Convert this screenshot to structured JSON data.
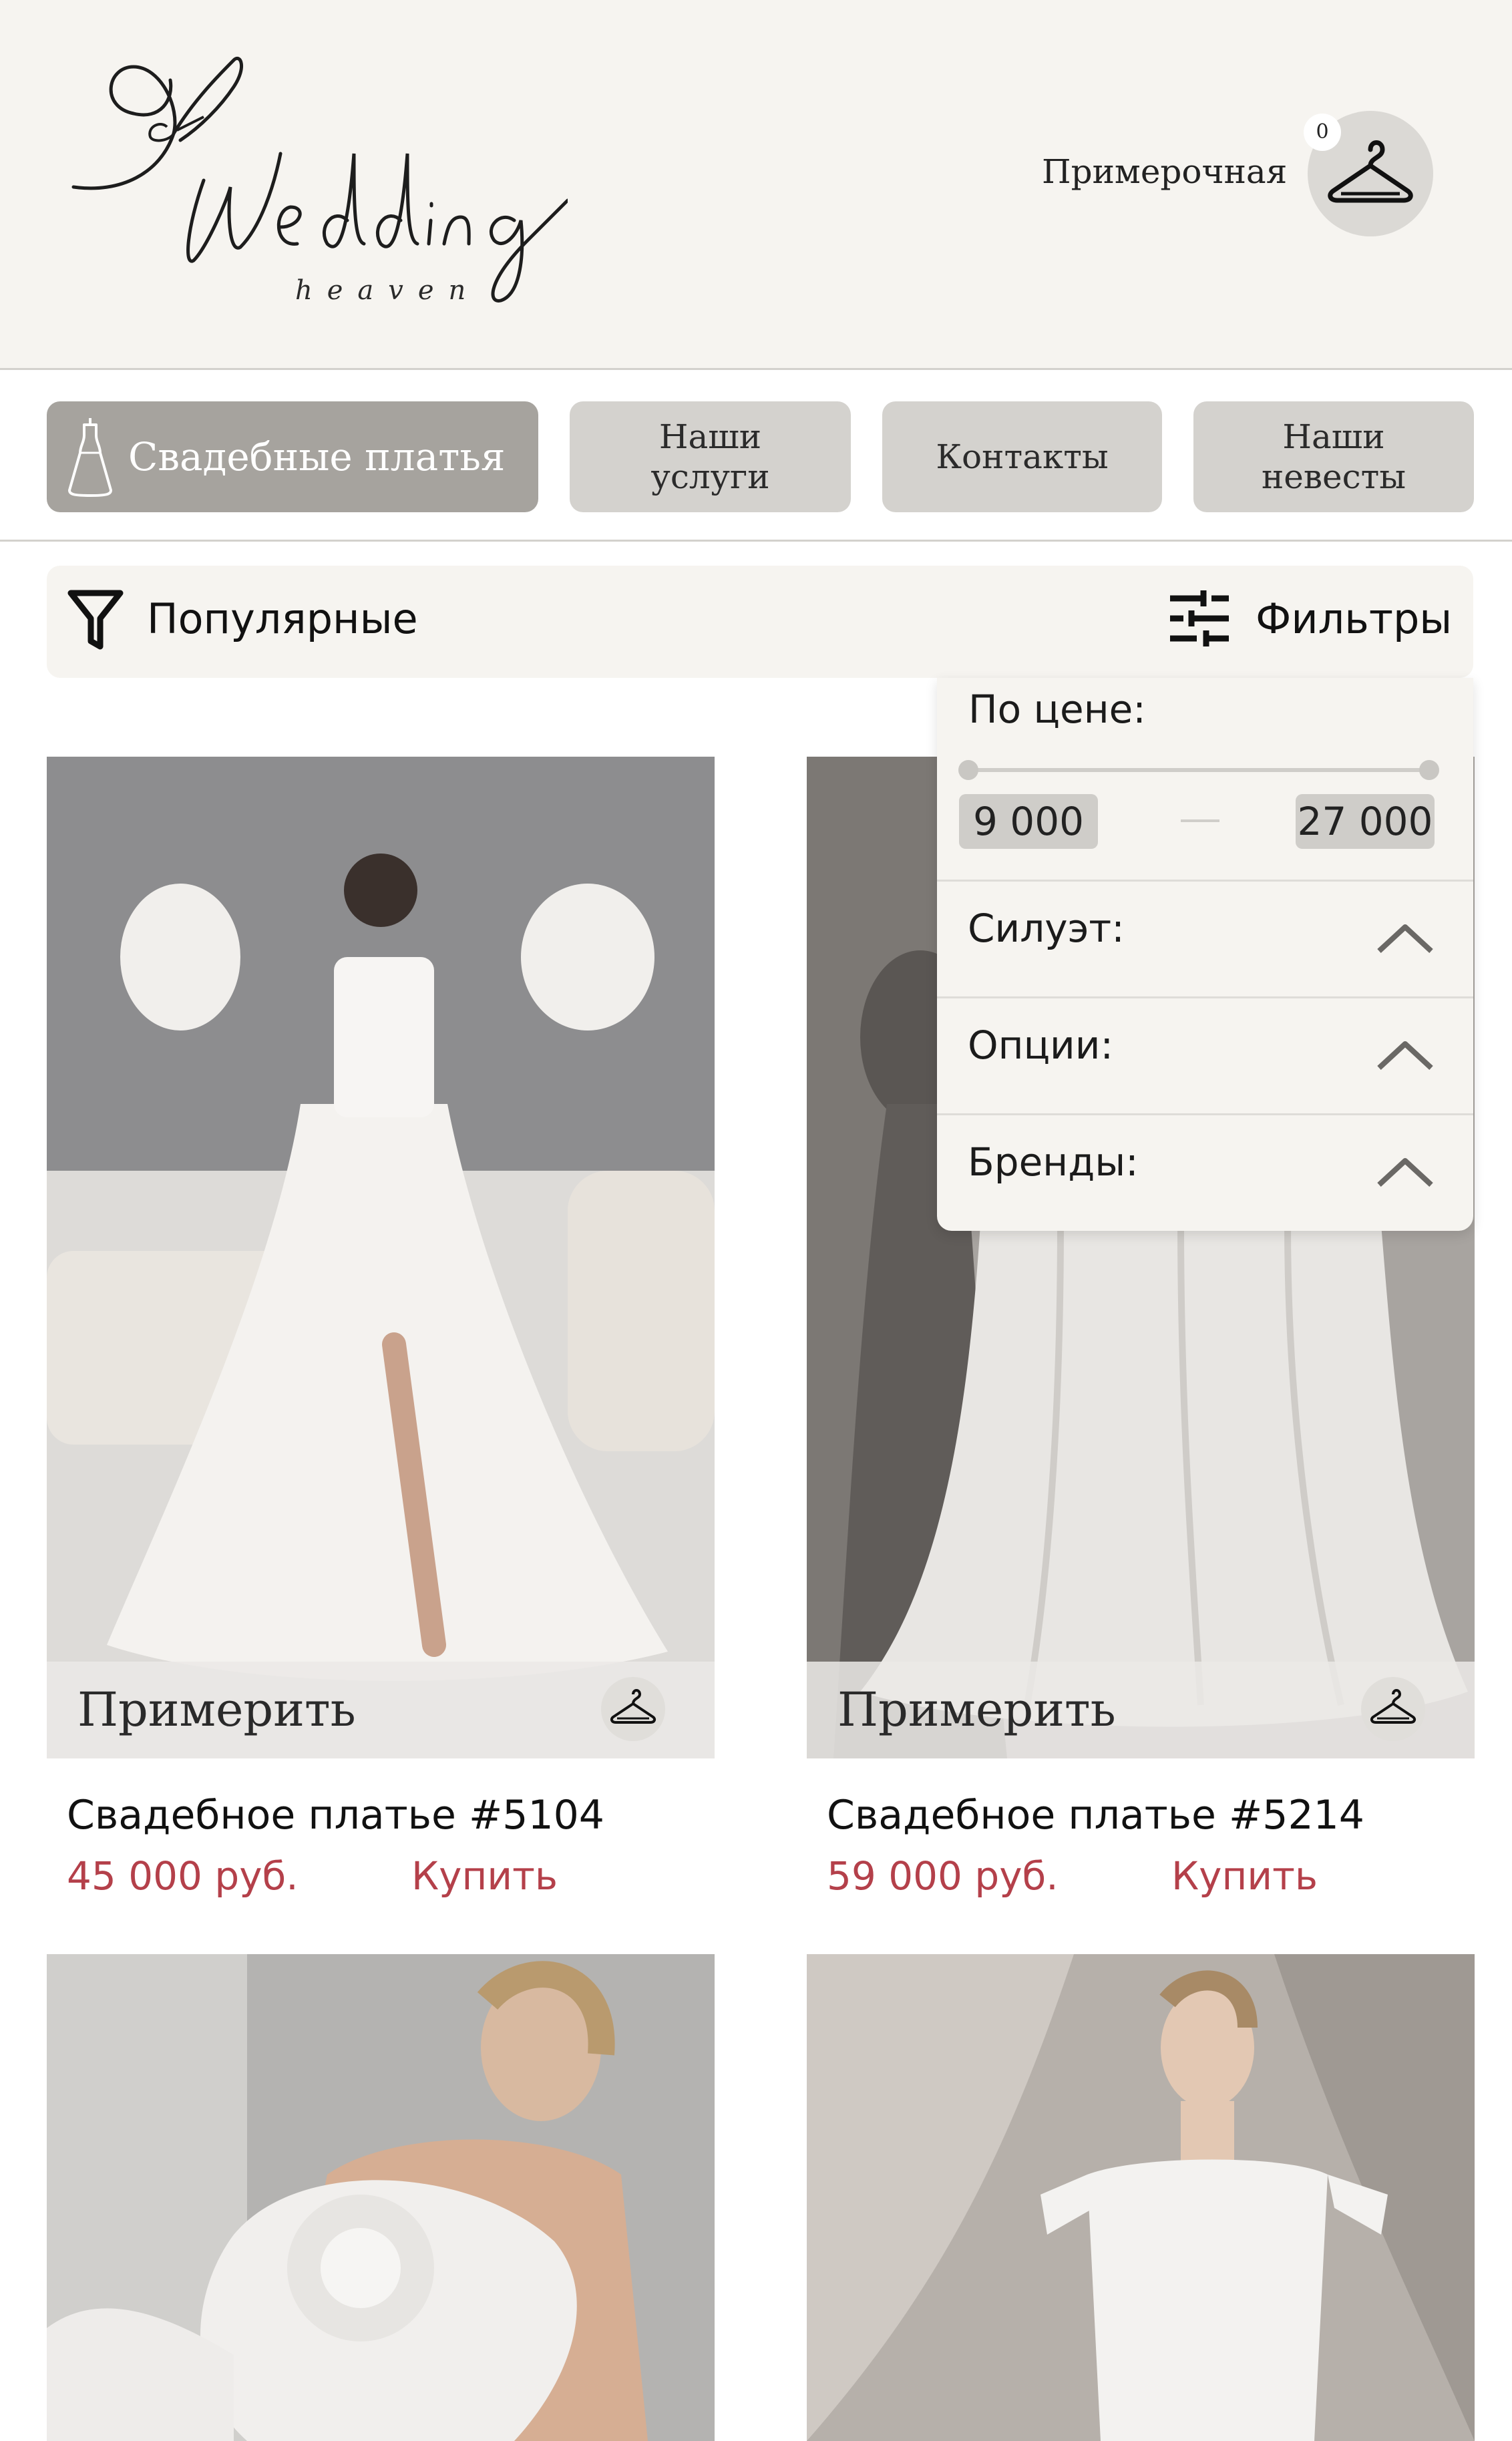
{
  "header": {
    "logo_script": "Wedding",
    "logo_subtitle": "heaven",
    "fitting_room_label": "Примерочная",
    "fitting_room_count": "0"
  },
  "nav": {
    "items": [
      {
        "label": "Свадебные платья",
        "active": true
      },
      {
        "label": "Наши услуги",
        "active": false
      },
      {
        "label": "Контакты",
        "active": false
      },
      {
        "label": "Наши невесты",
        "active": false
      }
    ]
  },
  "toolbar": {
    "sort_label": "Популярные",
    "filter_label": "Фильтры"
  },
  "filter_panel": {
    "price_label": "По цене:",
    "price_min": "9 000",
    "price_max": "27 000",
    "sections": [
      {
        "label": "Силуэт:",
        "icon": "chevron-up-icon"
      },
      {
        "label": "Опции:",
        "icon": "chevron-up-icon"
      },
      {
        "label": "Бренды:",
        "icon": "chevron-up-icon"
      }
    ]
  },
  "products": [
    {
      "title": "Свадебное платье #5104",
      "price": "45 000 руб.",
      "buy_label": "Купить",
      "try_label": "Примерить"
    },
    {
      "title": "Свадебное платье #5214",
      "price": "59 000 руб.",
      "buy_label": "Купить",
      "try_label": "Примерить"
    },
    {
      "title": "",
      "price": "",
      "buy_label": "",
      "try_label": ""
    },
    {
      "title": "",
      "price": "",
      "buy_label": "",
      "try_label": ""
    }
  ],
  "colors": {
    "header_bg": "#f6f4f0",
    "nav_button": "#d4d2ce",
    "nav_active": "#a6a39e",
    "accent_price": "#b4404a"
  }
}
